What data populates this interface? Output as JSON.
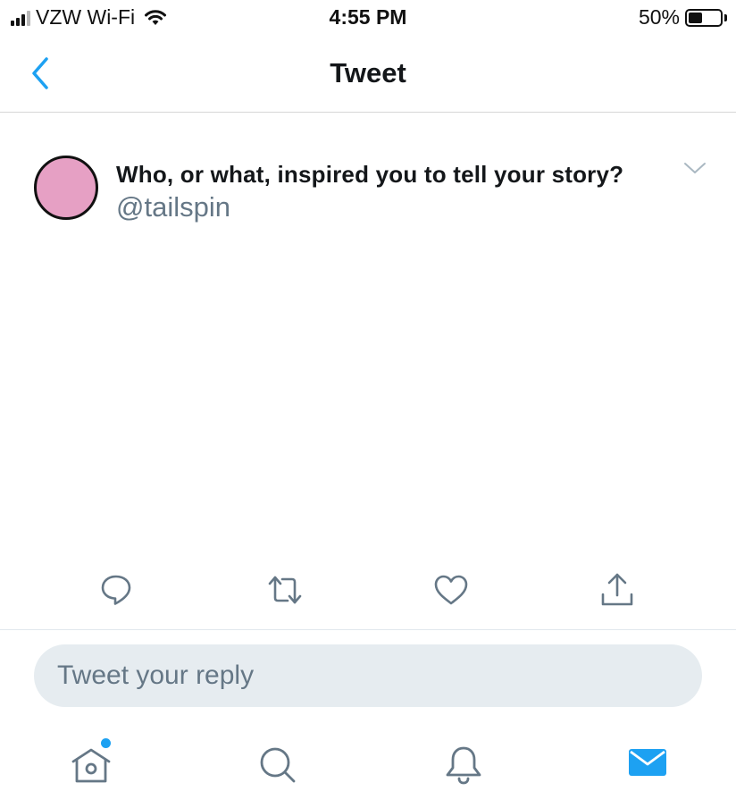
{
  "status_bar": {
    "carrier": "VZW Wi-Fi",
    "time": "4:55 PM",
    "battery_percent": "50%",
    "battery_level": 0.5,
    "signal_bars_total": 4,
    "signal_bars_filled": 3,
    "wifi_icon": "wifi-icon"
  },
  "nav": {
    "title": "Tweet",
    "back_icon": "chevron-left-icon",
    "accent_color": "#1da1f2"
  },
  "tweet": {
    "text": "Who, or what, inspired you to tell your story?",
    "handle": "@tailspin",
    "avatar_color": "#e6a0c4",
    "menu_icon": "chevron-down-icon"
  },
  "actions": [
    {
      "name": "reply",
      "icon": "comment-icon"
    },
    {
      "name": "retweet",
      "icon": "retweet-icon"
    },
    {
      "name": "like",
      "icon": "heart-icon"
    },
    {
      "name": "share",
      "icon": "share-icon"
    }
  ],
  "reply": {
    "placeholder": "Tweet your reply"
  },
  "tab_bar": {
    "items": [
      {
        "name": "home",
        "icon": "home-icon",
        "has_notification": true
      },
      {
        "name": "search",
        "icon": "search-icon"
      },
      {
        "name": "notifications",
        "icon": "bell-icon"
      },
      {
        "name": "messages",
        "icon": "mail-icon",
        "active": true
      }
    ],
    "active_color": "#1da1f2",
    "inactive_color": "#657786"
  }
}
